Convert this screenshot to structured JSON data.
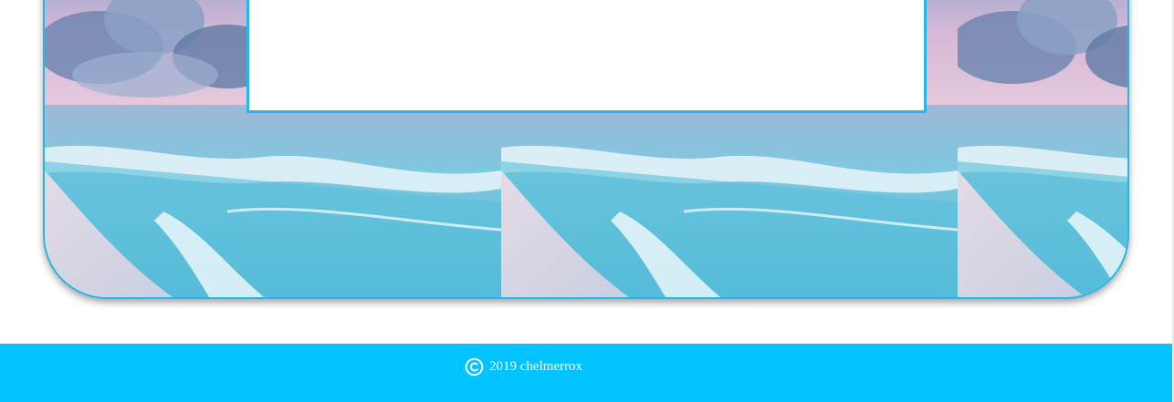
{
  "footer": {
    "year_owner": "2019 chelmerrox",
    "icon": "copyright-icon",
    "background_color": "#00c3ff",
    "text_color": "#ffffff"
  },
  "colors": {
    "accent_border": "#29b6e8"
  }
}
